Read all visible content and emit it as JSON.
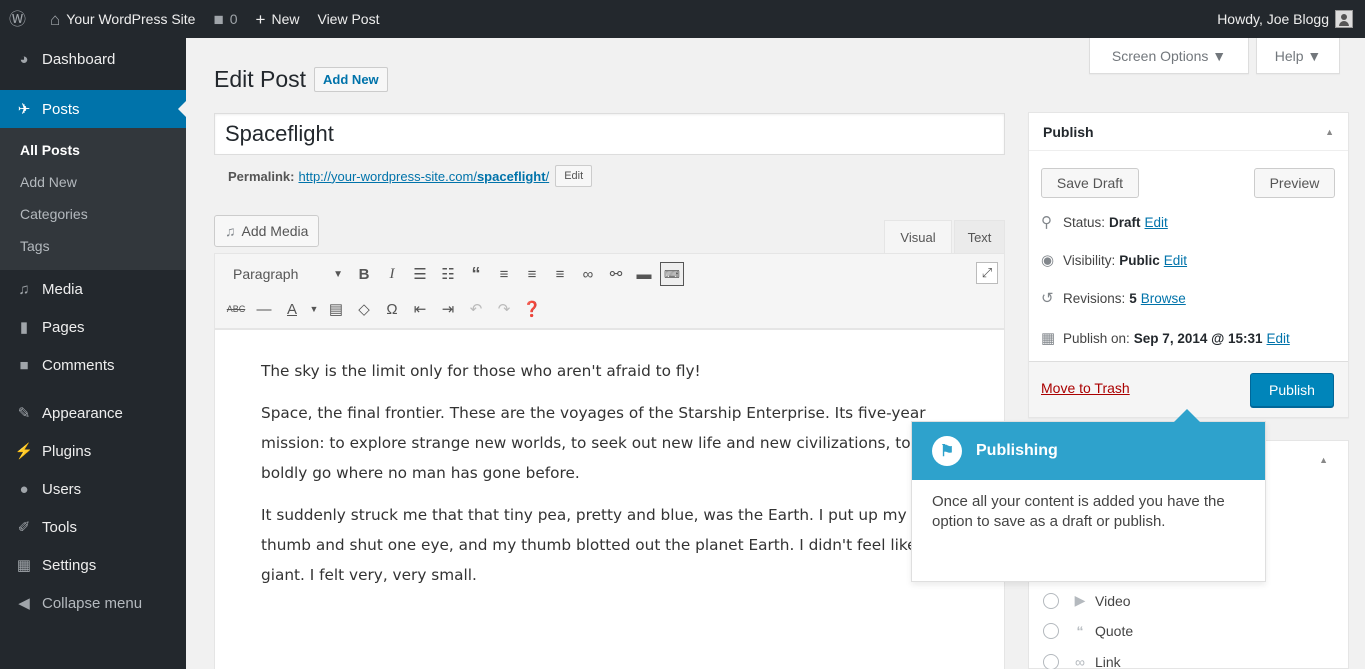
{
  "adminbar": {
    "site_name": "Your WordPress Site",
    "comments_count": "0",
    "new_label": "New",
    "view_post_label": "View Post",
    "howdy": "Howdy, Joe Blogg"
  },
  "sidebar": {
    "dashboard": "Dashboard",
    "posts": "Posts",
    "submenu": [
      "All Posts",
      "Add New",
      "Categories",
      "Tags"
    ],
    "media": "Media",
    "pages": "Pages",
    "comments": "Comments",
    "appearance": "Appearance",
    "plugins": "Plugins",
    "users": "Users",
    "tools": "Tools",
    "settings": "Settings",
    "collapse": "Collapse menu"
  },
  "tabs": {
    "screen_options": "Screen Options ▼",
    "help": "Help ▼"
  },
  "page": {
    "title": "Edit Post",
    "add_new": "Add New"
  },
  "post": {
    "title": "Spaceflight",
    "permalink_label": "Permalink:",
    "permalink_base": "http://your-wordpress-site.com/",
    "permalink_slug": "spaceflight",
    "permalink_end": "/",
    "permalink_edit": "Edit"
  },
  "editor": {
    "add_media": "Add Media",
    "tab_visual": "Visual",
    "tab_text": "Text",
    "format": "Paragraph",
    "paragraphs": [
      "The sky is the limit only for those who aren't afraid to fly!",
      "Space, the final frontier. These are the voyages of the Starship Enterprise. Its five-year mission: to explore strange new worlds, to seek out new life and new civilizations, to boldly go where no man has gone before.",
      "It suddenly struck me that that tiny pea, pretty and blue, was the Earth. I put up my thumb and shut one eye, and my thumb blotted out the planet Earth. I didn't feel like a giant. I felt very, very small."
    ]
  },
  "publish": {
    "heading": "Publish",
    "save_draft": "Save Draft",
    "preview": "Preview",
    "status_label": "Status:",
    "status_value": "Draft",
    "visibility_label": "Visibility:",
    "visibility_value": "Public",
    "revisions_label": "Revisions:",
    "revisions_value": "5",
    "browse": "Browse",
    "publish_on_label": "Publish on:",
    "publish_on_value": "Sep 7, 2014 @ 15:31",
    "edit": "Edit",
    "move_to_trash": "Move to Trash",
    "publish_button": "Publish"
  },
  "format_box": {
    "items": [
      "Video",
      "Quote",
      "Link"
    ]
  },
  "pointer": {
    "title": "Publishing",
    "body": "Once all your content is added you have the option to save as a draft or publish."
  },
  "colors": {
    "admin_dark": "#23282d",
    "accent_blue": "#0073aa",
    "pointer_blue": "#2ea2cc",
    "trash_red": "#a00"
  }
}
